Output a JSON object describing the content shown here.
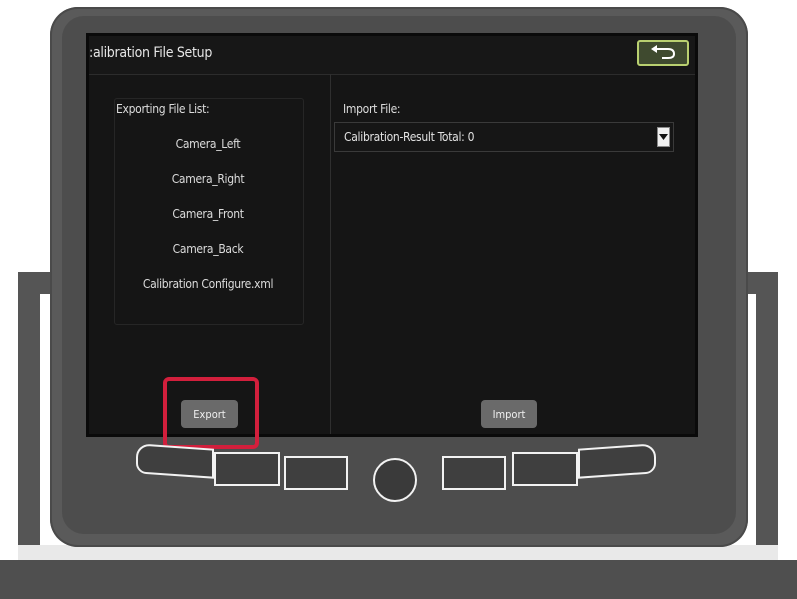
{
  "window": {
    "title": ":alibration File Setup"
  },
  "export_panel": {
    "list_title": "Exporting File List:",
    "files": [
      "Camera_Left",
      "Camera_Right",
      "Camera_Front",
      "Camera_Back",
      "Calibration Configure.xml"
    ],
    "export_button": "Export"
  },
  "import_panel": {
    "label": "Import File:",
    "selected": "Calibration-Result Total: 0",
    "import_button": "Import"
  },
  "icons": {
    "back": "back-arrow-icon",
    "dropdown": "chevron-down-icon"
  },
  "colors": {
    "highlight": "#d21f3c",
    "back_button_border": "#b9d070",
    "screen_bg": "#151515"
  }
}
